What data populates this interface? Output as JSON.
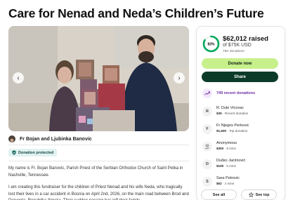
{
  "campaign": {
    "title": "Care for Nenad and Neda’s Children’s Future",
    "organizer_name": "Fr Bojan and Ljubinka Banovic",
    "protected_label": "Donation protected",
    "story": [
      "My name is Fr. Bojan Banovic, Parish Priest of the Serbian Orthodox Church of Saint Petka in Nashville, Tennessee.",
      "I am creating this fundraiser for the children of Priest Nenad and his wife Neda, who tragically lost their lives in a car accident in Bosnia on April 2nd, 2026, on the main road between Brod and Derventa, Republika Srpska. Their sudden passing has left their family"
    ]
  },
  "progress": {
    "percent_label": "83%",
    "fraction": 0.83,
    "raised": "$62,012 raised",
    "goal": "of $75K USD",
    "donations_count": "75K donations"
  },
  "actions": {
    "donate_label": "Donate now",
    "share_label": "Share",
    "see_all_label": "See all",
    "see_top_label": "See top"
  },
  "recent": {
    "label": "749 recent donations"
  },
  "donations": [
    {
      "initial": "R",
      "icon": "",
      "name": "R. Dule Vicovac",
      "amount": "$35",
      "detail": "Recent donation"
    },
    {
      "initial": "F",
      "icon": "",
      "name": "Fr Njegos Perkovic",
      "amount": "$1,500",
      "detail": "Top donation"
    },
    {
      "initial": "",
      "icon": "hand-heart-icon",
      "name": "Anonymous",
      "amount": "$300",
      "detail": "6 mins"
    },
    {
      "initial": "D",
      "icon": "",
      "name": "Duško Jaćimović",
      "amount": "$100",
      "detail": "5 mins"
    },
    {
      "initial": "S",
      "icon": "",
      "name": "Sara Petrovic",
      "amount": "$62",
      "detail": "2 mins"
    }
  ],
  "colors": {
    "brand_green": "#02a95c",
    "donate_button": "#c7f08b",
    "share_button": "#0c3b2a",
    "recent_purple": "#6b2fa3",
    "protected_bg": "#e0f2f1"
  }
}
